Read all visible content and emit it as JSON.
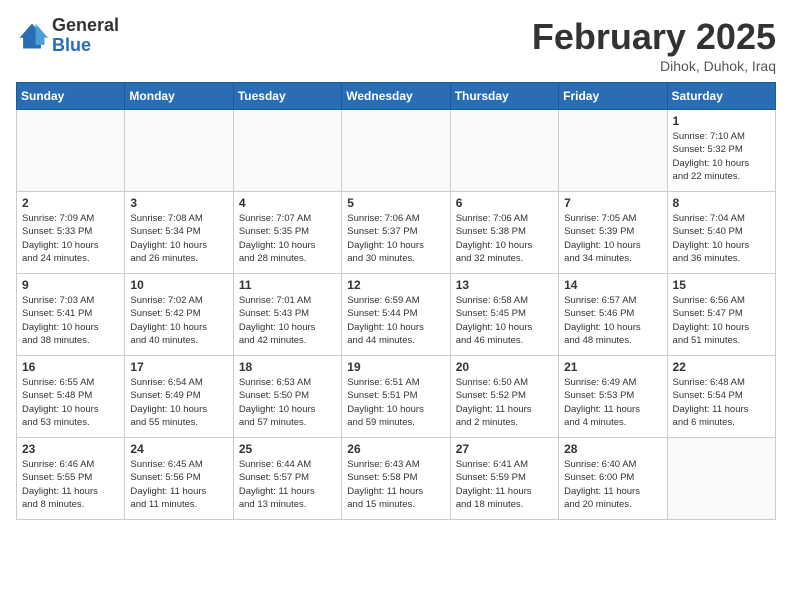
{
  "logo": {
    "general": "General",
    "blue": "Blue"
  },
  "header": {
    "title": "February 2025",
    "subtitle": "Dihok, Duhok, Iraq"
  },
  "weekdays": [
    "Sunday",
    "Monday",
    "Tuesday",
    "Wednesday",
    "Thursday",
    "Friday",
    "Saturday"
  ],
  "weeks": [
    [
      {
        "day": "",
        "info": ""
      },
      {
        "day": "",
        "info": ""
      },
      {
        "day": "",
        "info": ""
      },
      {
        "day": "",
        "info": ""
      },
      {
        "day": "",
        "info": ""
      },
      {
        "day": "",
        "info": ""
      },
      {
        "day": "1",
        "info": "Sunrise: 7:10 AM\nSunset: 5:32 PM\nDaylight: 10 hours\nand 22 minutes."
      }
    ],
    [
      {
        "day": "2",
        "info": "Sunrise: 7:09 AM\nSunset: 5:33 PM\nDaylight: 10 hours\nand 24 minutes."
      },
      {
        "day": "3",
        "info": "Sunrise: 7:08 AM\nSunset: 5:34 PM\nDaylight: 10 hours\nand 26 minutes."
      },
      {
        "day": "4",
        "info": "Sunrise: 7:07 AM\nSunset: 5:35 PM\nDaylight: 10 hours\nand 28 minutes."
      },
      {
        "day": "5",
        "info": "Sunrise: 7:06 AM\nSunset: 5:37 PM\nDaylight: 10 hours\nand 30 minutes."
      },
      {
        "day": "6",
        "info": "Sunrise: 7:06 AM\nSunset: 5:38 PM\nDaylight: 10 hours\nand 32 minutes."
      },
      {
        "day": "7",
        "info": "Sunrise: 7:05 AM\nSunset: 5:39 PM\nDaylight: 10 hours\nand 34 minutes."
      },
      {
        "day": "8",
        "info": "Sunrise: 7:04 AM\nSunset: 5:40 PM\nDaylight: 10 hours\nand 36 minutes."
      }
    ],
    [
      {
        "day": "9",
        "info": "Sunrise: 7:03 AM\nSunset: 5:41 PM\nDaylight: 10 hours\nand 38 minutes."
      },
      {
        "day": "10",
        "info": "Sunrise: 7:02 AM\nSunset: 5:42 PM\nDaylight: 10 hours\nand 40 minutes."
      },
      {
        "day": "11",
        "info": "Sunrise: 7:01 AM\nSunset: 5:43 PM\nDaylight: 10 hours\nand 42 minutes."
      },
      {
        "day": "12",
        "info": "Sunrise: 6:59 AM\nSunset: 5:44 PM\nDaylight: 10 hours\nand 44 minutes."
      },
      {
        "day": "13",
        "info": "Sunrise: 6:58 AM\nSunset: 5:45 PM\nDaylight: 10 hours\nand 46 minutes."
      },
      {
        "day": "14",
        "info": "Sunrise: 6:57 AM\nSunset: 5:46 PM\nDaylight: 10 hours\nand 48 minutes."
      },
      {
        "day": "15",
        "info": "Sunrise: 6:56 AM\nSunset: 5:47 PM\nDaylight: 10 hours\nand 51 minutes."
      }
    ],
    [
      {
        "day": "16",
        "info": "Sunrise: 6:55 AM\nSunset: 5:48 PM\nDaylight: 10 hours\nand 53 minutes."
      },
      {
        "day": "17",
        "info": "Sunrise: 6:54 AM\nSunset: 5:49 PM\nDaylight: 10 hours\nand 55 minutes."
      },
      {
        "day": "18",
        "info": "Sunrise: 6:53 AM\nSunset: 5:50 PM\nDaylight: 10 hours\nand 57 minutes."
      },
      {
        "day": "19",
        "info": "Sunrise: 6:51 AM\nSunset: 5:51 PM\nDaylight: 10 hours\nand 59 minutes."
      },
      {
        "day": "20",
        "info": "Sunrise: 6:50 AM\nSunset: 5:52 PM\nDaylight: 11 hours\nand 2 minutes."
      },
      {
        "day": "21",
        "info": "Sunrise: 6:49 AM\nSunset: 5:53 PM\nDaylight: 11 hours\nand 4 minutes."
      },
      {
        "day": "22",
        "info": "Sunrise: 6:48 AM\nSunset: 5:54 PM\nDaylight: 11 hours\nand 6 minutes."
      }
    ],
    [
      {
        "day": "23",
        "info": "Sunrise: 6:46 AM\nSunset: 5:55 PM\nDaylight: 11 hours\nand 8 minutes."
      },
      {
        "day": "24",
        "info": "Sunrise: 6:45 AM\nSunset: 5:56 PM\nDaylight: 11 hours\nand 11 minutes."
      },
      {
        "day": "25",
        "info": "Sunrise: 6:44 AM\nSunset: 5:57 PM\nDaylight: 11 hours\nand 13 minutes."
      },
      {
        "day": "26",
        "info": "Sunrise: 6:43 AM\nSunset: 5:58 PM\nDaylight: 11 hours\nand 15 minutes."
      },
      {
        "day": "27",
        "info": "Sunrise: 6:41 AM\nSunset: 5:59 PM\nDaylight: 11 hours\nand 18 minutes."
      },
      {
        "day": "28",
        "info": "Sunrise: 6:40 AM\nSunset: 6:00 PM\nDaylight: 11 hours\nand 20 minutes."
      },
      {
        "day": "",
        "info": ""
      }
    ]
  ]
}
